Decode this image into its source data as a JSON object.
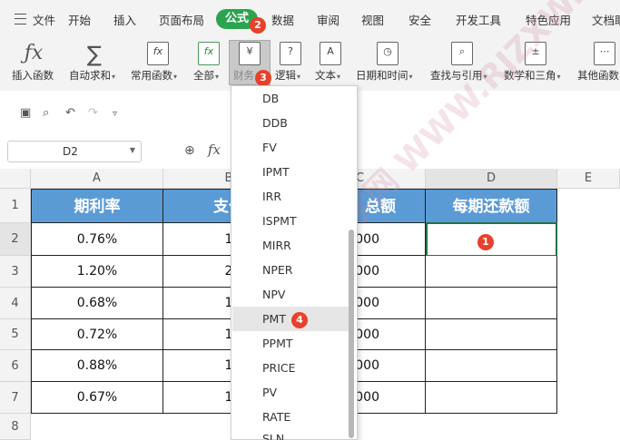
{
  "menu": {
    "file": "文件",
    "tabs": [
      "开始",
      "插入",
      "页面布局",
      "公式",
      "数据",
      "审阅",
      "视图",
      "安全",
      "开发工具",
      "特色应用",
      "文档助"
    ]
  },
  "ribbon": {
    "buttons": [
      "插入函数",
      "自动求和",
      "常用函数",
      "全部",
      "财务",
      "逻辑",
      "文本",
      "日期和时间",
      "查找与引用",
      "数学和三角",
      "其他函数"
    ]
  },
  "namebox": {
    "value": "D2"
  },
  "formula_bar": {
    "fx": "fx"
  },
  "columns": [
    "A",
    "B",
    "C",
    "D",
    "E"
  ],
  "rows": [
    "1",
    "2",
    "3",
    "4",
    "5",
    "6",
    "7",
    "8"
  ],
  "table": {
    "headers": [
      "期利率",
      "支付",
      "总额",
      "每期还款额"
    ],
    "rows": [
      [
        "0.76%",
        "1",
        "000",
        ""
      ],
      [
        "1.20%",
        "2",
        "000",
        ""
      ],
      [
        "0.68%",
        "1",
        "000",
        ""
      ],
      [
        "0.72%",
        "1",
        "000",
        ""
      ],
      [
        "0.88%",
        "1",
        "000",
        ""
      ],
      [
        "0.67%",
        "1",
        "000",
        ""
      ]
    ]
  },
  "dropdown": {
    "items": [
      "DB",
      "DDB",
      "FV",
      "IPMT",
      "IRR",
      "ISPMT",
      "MIRR",
      "NPER",
      "NPV",
      "PMT",
      "PPMT",
      "PRICE",
      "PV",
      "RATE",
      "SLN"
    ],
    "selected": "PMT"
  },
  "badges": {
    "cell": "1",
    "formula_tab": "2",
    "finance": "3",
    "pmt": "4"
  },
  "watermark": "软件自学网 WWW.RJZXW.COM",
  "colors": {
    "header_fill": "#5b9bd5",
    "active_tab": "#2aa44f",
    "badge": "#e8412c",
    "selection": "#217346"
  }
}
